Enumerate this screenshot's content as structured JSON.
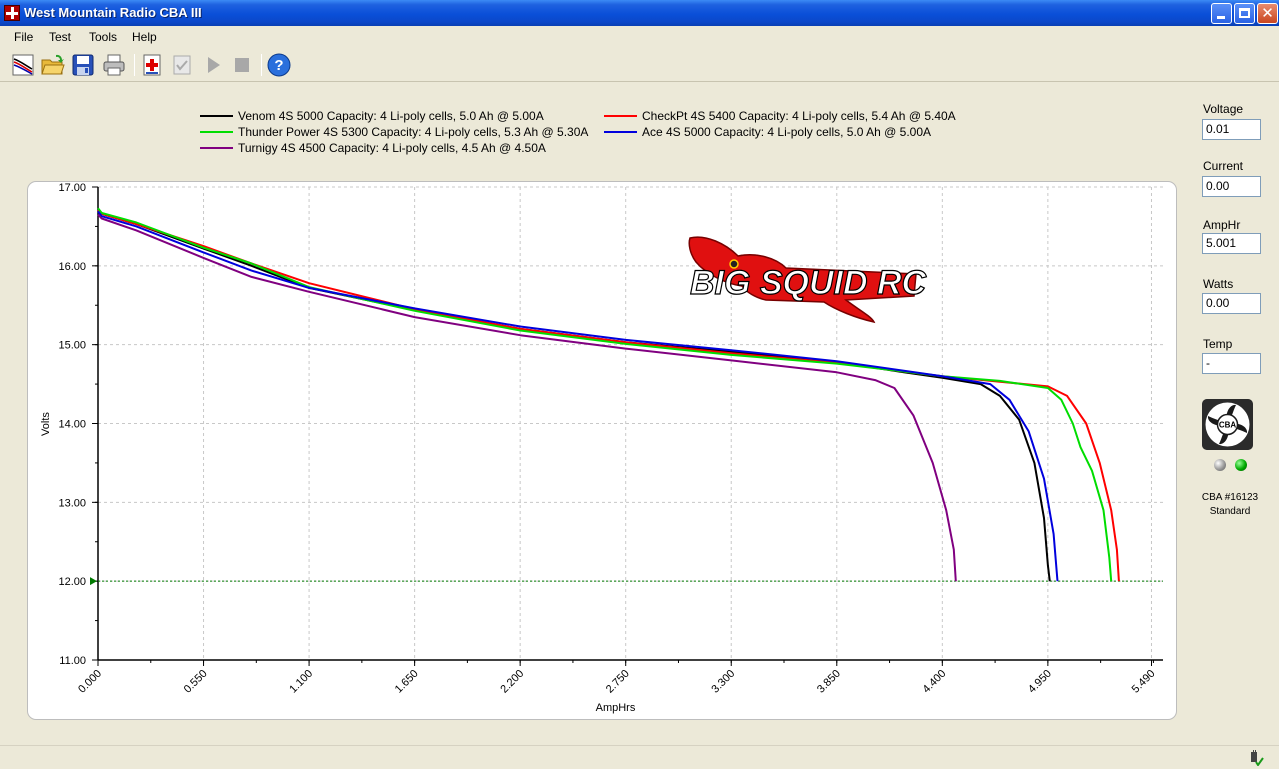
{
  "window": {
    "title": "West Mountain Radio CBA III",
    "icons": {
      "app": "app-logo-icon",
      "minimize": "minimize-icon",
      "maximize": "maximize-icon",
      "close": "close-icon"
    },
    "close_glyph": "✕"
  },
  "menu": {
    "items": [
      "File",
      "Test",
      "Tools",
      "Help"
    ]
  },
  "toolbar": {
    "buttons": [
      {
        "icon": "graph-new-icon",
        "enabled": true
      },
      {
        "icon": "open-folder-icon",
        "enabled": true
      },
      {
        "icon": "save-disk-icon",
        "enabled": true
      },
      {
        "icon": "print-icon",
        "enabled": true
      },
      {
        "icon": "add-test-icon",
        "enabled": true
      },
      {
        "icon": "check-test-icon",
        "enabled": false
      },
      {
        "icon": "play-icon",
        "enabled": false
      },
      {
        "icon": "stop-icon",
        "enabled": false
      },
      {
        "icon": "help-icon",
        "enabled": true
      }
    ]
  },
  "readouts": {
    "voltage_label": "Voltage",
    "voltage_value": "0.01",
    "current_label": "Current",
    "current_value": "0.00",
    "amphr_label": "AmpHr",
    "amphr_value": "5.001",
    "watts_label": "Watts",
    "watts_value": "0.00",
    "temp_label": "Temp",
    "temp_value": "-"
  },
  "device": {
    "fan_icon": "fan-icon",
    "fan_label": "CBA",
    "name": "CBA #16123",
    "mode": "Standard",
    "leds": [
      {
        "icon": "status-led-gray-icon",
        "color": "#9a9a9a"
      },
      {
        "icon": "status-led-green-icon",
        "color": "#00aa00"
      }
    ]
  },
  "logo": {
    "text": "BIG SQUID RC",
    "icon": "squid-logo-icon"
  },
  "status_bar": {
    "icon": "usb-connected-icon"
  },
  "chart_data": {
    "type": "line",
    "xlabel": "AmpHrs",
    "ylabel": "Volts",
    "xlim": [
      0,
      5.55
    ],
    "ylim": [
      11.0,
      17.0
    ],
    "x_ticks": [
      "0.000",
      "0.550",
      "1.100",
      "1.650",
      "2.200",
      "2.750",
      "3.300",
      "3.850",
      "4.400",
      "4.950",
      "5.490"
    ],
    "y_ticks": [
      "17.00",
      "16.00",
      "15.00",
      "14.00",
      "13.00",
      "12.00",
      "11.00"
    ],
    "grid": true,
    "legend_position": "top",
    "cutoff_line": {
      "y": 12.0,
      "color": "#007a00"
    },
    "series": [
      {
        "name": "Venom 4S 5000 Capacity: 4 Li-poly cells, 5.0 Ah @ 5.00A",
        "color": "#000000",
        "points": [
          [
            0,
            16.72
          ],
          [
            0.02,
            16.66
          ],
          [
            0.2,
            16.53
          ],
          [
            0.55,
            16.22
          ],
          [
            0.8,
            16.0
          ],
          [
            1.1,
            15.72
          ],
          [
            1.65,
            15.44
          ],
          [
            2.2,
            15.2
          ],
          [
            2.75,
            15.03
          ],
          [
            3.3,
            14.91
          ],
          [
            3.85,
            14.78
          ],
          [
            4.2,
            14.65
          ],
          [
            4.4,
            14.58
          ],
          [
            4.6,
            14.5
          ],
          [
            4.7,
            14.35
          ],
          [
            4.8,
            14.05
          ],
          [
            4.88,
            13.5
          ],
          [
            4.93,
            12.8
          ],
          [
            4.95,
            12.2
          ],
          [
            4.96,
            12.0
          ]
        ]
      },
      {
        "name": "CheckPt 4S 5400 Capacity: 4 Li-poly cells, 5.4 Ah @ 5.40A",
        "color": "#ff0000",
        "points": [
          [
            0,
            16.71
          ],
          [
            0.02,
            16.66
          ],
          [
            0.2,
            16.53
          ],
          [
            0.55,
            16.25
          ],
          [
            0.8,
            16.03
          ],
          [
            1.1,
            15.78
          ],
          [
            1.65,
            15.45
          ],
          [
            2.2,
            15.2
          ],
          [
            2.75,
            15.03
          ],
          [
            3.3,
            14.89
          ],
          [
            3.85,
            14.77
          ],
          [
            4.2,
            14.66
          ],
          [
            4.4,
            14.6
          ],
          [
            4.7,
            14.53
          ],
          [
            4.95,
            14.47
          ],
          [
            5.05,
            14.35
          ],
          [
            5.15,
            14.0
          ],
          [
            5.22,
            13.5
          ],
          [
            5.28,
            12.9
          ],
          [
            5.31,
            12.4
          ],
          [
            5.32,
            12.0
          ]
        ]
      },
      {
        "name": "Thunder Power 4S 5300 Capacity: 4 Li-poly cells, 5.3 Ah @ 5.30A",
        "color": "#00dd00",
        "points": [
          [
            0,
            16.73
          ],
          [
            0.02,
            16.67
          ],
          [
            0.2,
            16.55
          ],
          [
            0.55,
            16.23
          ],
          [
            0.8,
            16.03
          ],
          [
            1.1,
            15.73
          ],
          [
            1.65,
            15.43
          ],
          [
            2.2,
            15.18
          ],
          [
            2.75,
            15.01
          ],
          [
            3.3,
            14.87
          ],
          [
            3.85,
            14.76
          ],
          [
            4.2,
            14.66
          ],
          [
            4.4,
            14.6
          ],
          [
            4.7,
            14.54
          ],
          [
            4.95,
            14.45
          ],
          [
            5.02,
            14.3
          ],
          [
            5.08,
            14.0
          ],
          [
            5.12,
            13.7
          ],
          [
            5.18,
            13.4
          ],
          [
            5.24,
            12.9
          ],
          [
            5.27,
            12.3
          ],
          [
            5.28,
            12.0
          ]
        ]
      },
      {
        "name": "Ace 4S 5000 Capacity: 4 Li-poly cells, 5.0 Ah @ 5.00A",
        "color": "#0000dd",
        "points": [
          [
            0,
            16.69
          ],
          [
            0.02,
            16.63
          ],
          [
            0.2,
            16.5
          ],
          [
            0.55,
            16.17
          ],
          [
            0.8,
            15.94
          ],
          [
            1.1,
            15.72
          ],
          [
            1.65,
            15.46
          ],
          [
            2.2,
            15.23
          ],
          [
            2.75,
            15.06
          ],
          [
            3.3,
            14.93
          ],
          [
            3.85,
            14.79
          ],
          [
            4.2,
            14.67
          ],
          [
            4.4,
            14.6
          ],
          [
            4.65,
            14.5
          ],
          [
            4.75,
            14.3
          ],
          [
            4.85,
            13.9
          ],
          [
            4.93,
            13.3
          ],
          [
            4.98,
            12.6
          ],
          [
            5.0,
            12.0
          ]
        ]
      },
      {
        "name": "Turnigy 4S 4500 Capacity: 4 Li-poly cells, 4.5 Ah @ 4.50A",
        "color": "#800080",
        "points": [
          [
            0,
            16.65
          ],
          [
            0.02,
            16.6
          ],
          [
            0.2,
            16.45
          ],
          [
            0.55,
            16.1
          ],
          [
            0.8,
            15.86
          ],
          [
            1.1,
            15.67
          ],
          [
            1.65,
            15.35
          ],
          [
            2.2,
            15.12
          ],
          [
            2.75,
            14.95
          ],
          [
            3.3,
            14.8
          ],
          [
            3.85,
            14.65
          ],
          [
            4.05,
            14.55
          ],
          [
            4.15,
            14.45
          ],
          [
            4.25,
            14.1
          ],
          [
            4.35,
            13.5
          ],
          [
            4.42,
            12.9
          ],
          [
            4.46,
            12.4
          ],
          [
            4.47,
            12.0
          ]
        ]
      }
    ]
  }
}
